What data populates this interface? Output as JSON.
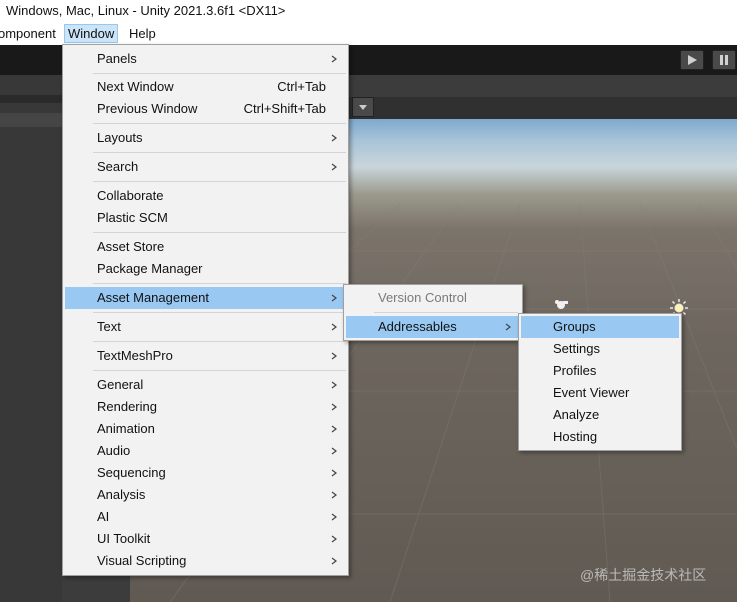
{
  "window": {
    "title": "Windows, Mac, Linux - Unity 2021.3.6f1 <DX11>"
  },
  "menubar": {
    "component_partial": "omponent",
    "window": "Window",
    "help": "Help"
  },
  "window_menu": {
    "panels": "Panels",
    "next_window": "Next Window",
    "next_window_shortcut": "Ctrl+Tab",
    "previous_window": "Previous Window",
    "previous_window_shortcut": "Ctrl+Shift+Tab",
    "layouts": "Layouts",
    "search": "Search",
    "collaborate": "Collaborate",
    "plastic_scm": "Plastic SCM",
    "asset_store": "Asset Store",
    "package_manager": "Package Manager",
    "asset_management": "Asset Management",
    "text": "Text",
    "textmeshpro": "TextMeshPro",
    "general": "General",
    "rendering": "Rendering",
    "animation": "Animation",
    "audio": "Audio",
    "sequencing": "Sequencing",
    "analysis": "Analysis",
    "ai": "AI",
    "ui_toolkit": "UI Toolkit",
    "visual_scripting": "Visual Scripting"
  },
  "asset_management_menu": {
    "version_control": "Version Control",
    "addressables": "Addressables"
  },
  "addressables_menu": {
    "groups": "Groups",
    "settings": "Settings",
    "profiles": "Profiles",
    "event_viewer": "Event Viewer",
    "analyze": "Analyze",
    "hosting": "Hosting"
  },
  "watermark": "@稀土掘金技术社区",
  "colors": {
    "highlight": "#99c9f3",
    "menu_bg": "#f2f2f2",
    "toolbar_bg": "#191919"
  },
  "icons": {
    "play": "play-icon",
    "pause": "pause-icon",
    "submenu": "chevron-right-icon",
    "light": "sun-icon",
    "scene_gizmo": "gizmo-icon"
  }
}
